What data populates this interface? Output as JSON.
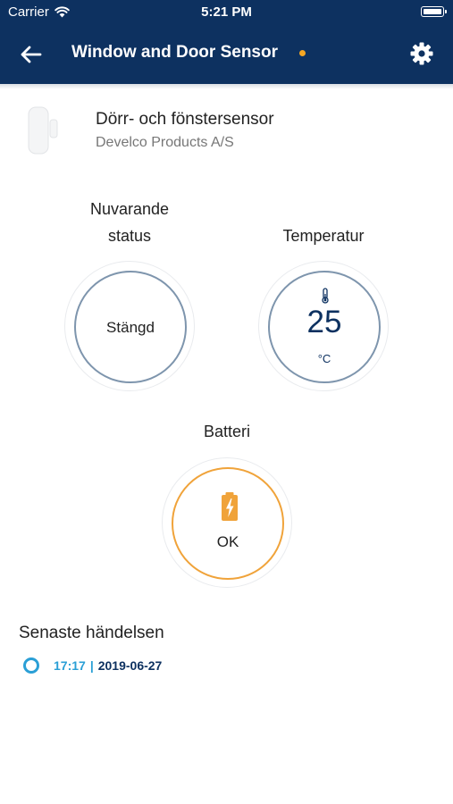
{
  "status_bar": {
    "carrier": "Carrier",
    "time": "5:21 PM"
  },
  "nav": {
    "title": "Window and Door Sensor"
  },
  "device": {
    "name": "Dörr- och fönstersensor",
    "manufacturer": "Develco Products A/S"
  },
  "tiles": {
    "status": {
      "label_line1": "Nuvarande",
      "label_line2": "status",
      "value": "Stängd"
    },
    "temperature": {
      "label": "Temperatur",
      "value": "25",
      "unit": "°C"
    },
    "battery": {
      "label": "Batteri",
      "value": "OK"
    }
  },
  "events": {
    "title": "Senaste händelsen",
    "latest": {
      "time": "17:17",
      "separator": "|",
      "date": "2019-06-27"
    }
  },
  "colors": {
    "primary": "#0d3160",
    "accent": "#f5a623",
    "ring": "#7e95ad",
    "battery_ring": "#f0a33a",
    "event": "#2a9fd6"
  },
  "icons": [
    "back-arrow-icon",
    "gear-icon",
    "wifi-icon",
    "battery-icon",
    "thermometer-icon",
    "battery-charging-icon",
    "event-circle-icon"
  ]
}
